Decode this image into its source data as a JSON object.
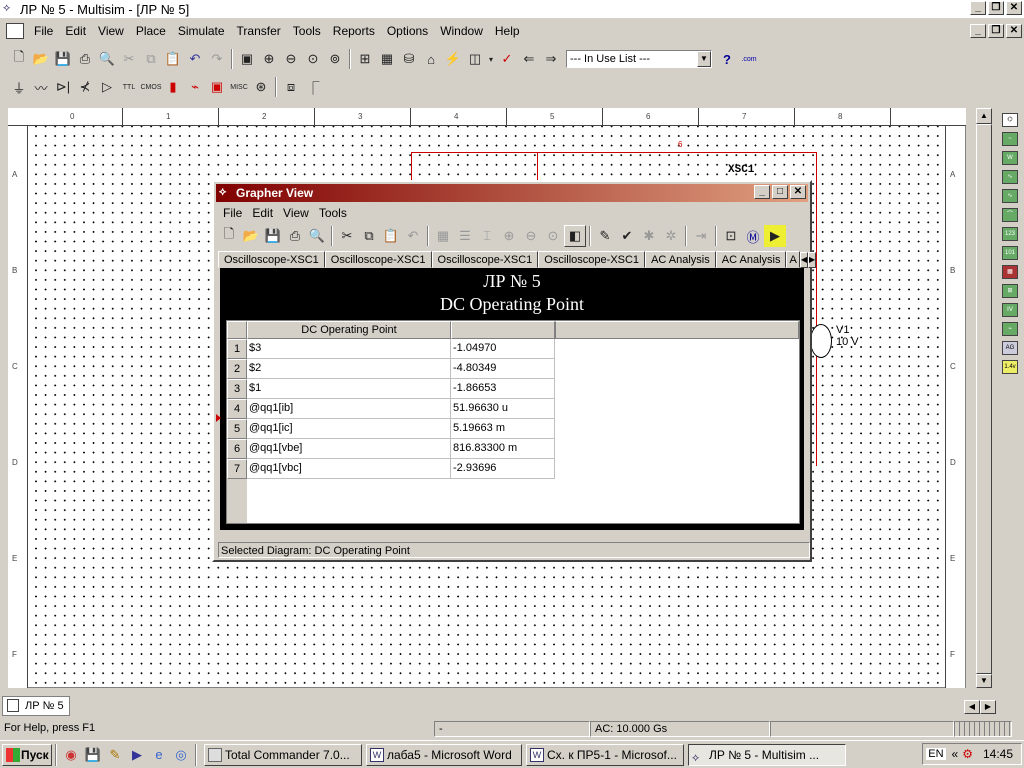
{
  "window": {
    "title": "ЛР № 5 - Multisim - [ЛР № 5]"
  },
  "menu": [
    "File",
    "Edit",
    "View",
    "Place",
    "Simulate",
    "Transfer",
    "Tools",
    "Reports",
    "Options",
    "Window",
    "Help"
  ],
  "toolbar": {
    "inuse_label": "--- In Use List ---"
  },
  "ruler": {
    "cols": [
      "0",
      "1",
      "2",
      "3",
      "4",
      "5",
      "6",
      "7",
      "8"
    ],
    "rows": [
      "A",
      "B",
      "C",
      "D",
      "E",
      "F"
    ]
  },
  "schematic": {
    "instrument_label": "XSC1",
    "wire_label": "6",
    "source_name": "V1",
    "source_value": "10 V"
  },
  "grapher": {
    "title": "Grapher View",
    "menu": [
      "File",
      "Edit",
      "View",
      "Tools"
    ],
    "tabs": [
      "Oscilloscope-XSC1",
      "Oscilloscope-XSC1",
      "Oscilloscope-XSC1",
      "Oscilloscope-XSC1",
      "AC Analysis",
      "AC Analysis",
      "A"
    ],
    "heading_line1": "ЛР № 5",
    "heading_line2": "DC Operating Point",
    "table": {
      "header": [
        "DC Operating Point",
        ""
      ],
      "rows": [
        {
          "n": "1",
          "name": "$3",
          "value": "-1.04970"
        },
        {
          "n": "2",
          "name": "$2",
          "value": "-4.80349"
        },
        {
          "n": "3",
          "name": "$1",
          "value": "-1.86653"
        },
        {
          "n": "4",
          "name": "@qq1[ib]",
          "value": "51.96630 u"
        },
        {
          "n": "5",
          "name": "@qq1[ic]",
          "value": "5.19663 m"
        },
        {
          "n": "6",
          "name": "@qq1[vbe]",
          "value": "816.83300 m"
        },
        {
          "n": "7",
          "name": "@qq1[vbc]",
          "value": "-2.93696"
        }
      ]
    },
    "status": "Selected Diagram:  DC Operating Point"
  },
  "doc_tab": "ЛР № 5",
  "statusbar": {
    "help": "For Help, press F1",
    "dash": "-",
    "ac": "AC: 10.000 Gs"
  },
  "taskbar": {
    "start": "Пуск",
    "tasks": [
      {
        "label": "Total Commander 7.0...",
        "active": false
      },
      {
        "label": "лаба5 - Microsoft Word",
        "active": false
      },
      {
        "label": "Сх. к ПР5-1 - Microsof...",
        "active": false
      },
      {
        "label": "ЛР № 5 - Multisim ...",
        "active": true
      }
    ],
    "lang": "EN",
    "chevron": "«",
    "clock": "14:45"
  },
  "colors": {
    "wire": "#cc0000",
    "grapher_title_start": "#800000",
    "grapher_title_end": "#e0a080",
    "selection_marker": "#cc0000"
  }
}
